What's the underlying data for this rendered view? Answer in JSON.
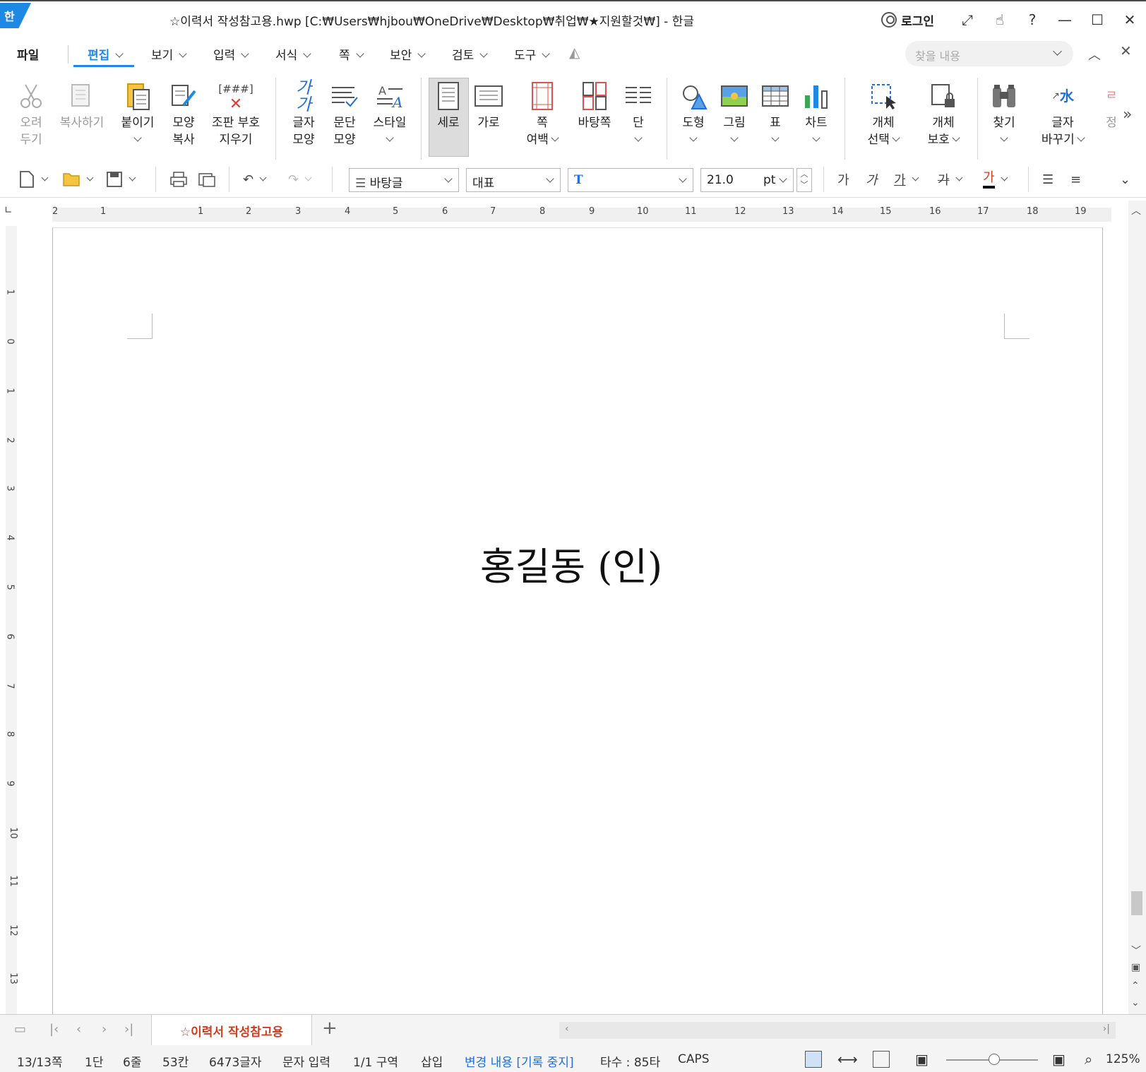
{
  "window": {
    "logo": "한",
    "title": "☆이력서 작성참고용.hwp [C:₩Users₩hjbou₩OneDrive₩Desktop₩취업₩★지원할것₩] - 한글",
    "login_label": "로그인",
    "controls": [
      "⤢",
      "☝",
      "?",
      "—",
      "☐",
      "✕"
    ]
  },
  "menu": {
    "items": [
      {
        "label": "파일"
      },
      {
        "label": "편집"
      },
      {
        "label": "보기"
      },
      {
        "label": "입력"
      },
      {
        "label": "서식"
      },
      {
        "label": "쪽"
      },
      {
        "label": "보안"
      },
      {
        "label": "검토"
      },
      {
        "label": "도구"
      }
    ],
    "active_index": 1,
    "search_placeholder": "찾을 내용"
  },
  "ribbon": {
    "buttons": [
      {
        "label1": "오려",
        "label2": "두기",
        "icon": "scissors-icon",
        "disabled": true
      },
      {
        "label1": "복사하기",
        "label2": "",
        "icon": "copy-icon",
        "disabled": true
      },
      {
        "label1": "붙이기",
        "label2": "",
        "icon": "paste-icon",
        "dropdown": true
      },
      {
        "label1": "모양",
        "label2": "복사",
        "icon": "format-painter-icon"
      },
      {
        "label1": "조판 부호",
        "label2": "지우기",
        "icon": "clear-code-icon",
        "glyph": "[###]"
      },
      {
        "label1": "글자",
        "label2": "모양",
        "icon": "char-shape-icon",
        "glyph": "가가"
      },
      {
        "label1": "문단",
        "label2": "모양",
        "icon": "para-shape-icon"
      },
      {
        "label1": "스타일",
        "label2": "",
        "icon": "style-icon",
        "dropdown": true
      },
      {
        "label1": "세로",
        "label2": "",
        "icon": "portrait-icon",
        "selected": true
      },
      {
        "label1": "가로",
        "label2": "",
        "icon": "landscape-icon"
      },
      {
        "label1": "쪽",
        "label2": "여백",
        "icon": "margin-icon",
        "dropdown": true
      },
      {
        "label1": "바탕쪽",
        "label2": "",
        "icon": "master-page-icon"
      },
      {
        "label1": "단",
        "label2": "",
        "icon": "columns-icon",
        "dropdown": true
      },
      {
        "label1": "도형",
        "label2": "",
        "icon": "shape-icon",
        "dropdown": true
      },
      {
        "label1": "그림",
        "label2": "",
        "icon": "picture-icon",
        "dropdown": true
      },
      {
        "label1": "표",
        "label2": "",
        "icon": "table-icon",
        "dropdown": true
      },
      {
        "label1": "차트",
        "label2": "",
        "icon": "chart-icon",
        "dropdown": true
      },
      {
        "label1": "개체",
        "label2": "선택",
        "icon": "select-object-icon",
        "dropdown": true
      },
      {
        "label1": "개체",
        "label2": "보호",
        "icon": "protect-object-icon",
        "dropdown": true
      },
      {
        "label1": "찾기",
        "label2": "",
        "icon": "binoculars-icon",
        "dropdown": true
      },
      {
        "label1": "글자",
        "label2": "바꾸기",
        "icon": "replace-icon",
        "dropdown": true,
        "glyph": "水"
      },
      {
        "label1": "정",
        "label2": "",
        "icon": "partial-icon",
        "disabled": true
      }
    ]
  },
  "format": {
    "style": "바탕글",
    "lang": "대표",
    "font_icon": "T",
    "size": "21.0",
    "unit": "pt",
    "char_glyphs": [
      "가",
      "가",
      "가",
      "가",
      "가"
    ]
  },
  "ruler": {
    "h_labels": [
      "2",
      "1",
      "1",
      "2",
      "3",
      "4",
      "5",
      "6",
      "7",
      "8",
      "9",
      "10",
      "11",
      "12",
      "13",
      "14",
      "15",
      "16",
      "17",
      "18",
      "19"
    ],
    "v_labels": [
      "1",
      "0",
      "1",
      "2",
      "3",
      "4",
      "5",
      "6",
      "7",
      "8",
      "9",
      "10",
      "11",
      "12",
      "13"
    ]
  },
  "document": {
    "text": "홍길동 (인)"
  },
  "tabs": {
    "doc_tab": "☆이력서 작성참고용",
    "add": "+"
  },
  "status": {
    "page": "13/13쪽",
    "column": "1단",
    "line": "6줄",
    "pos": "53칸",
    "chars": "6473글자",
    "mode": "문자 입력",
    "section": "1/1 구역",
    "insert": "삽입",
    "track": "변경 내용 [기록 중지]",
    "typing": "타수 : 85타",
    "caps": "CAPS",
    "zoom": "125%"
  }
}
